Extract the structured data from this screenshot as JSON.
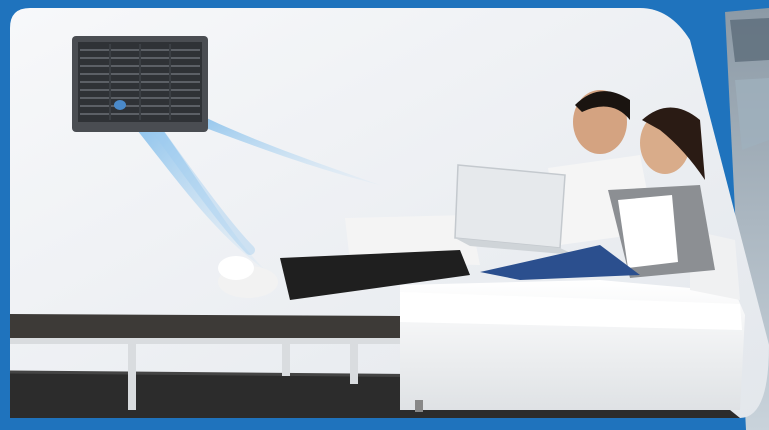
{
  "scene": {
    "description_free": true,
    "colors": {
      "frame_blue": "#1f73bd",
      "wall": "#eef1f4",
      "airflow": "#8fc6ee",
      "sofa": "#f6f6f6",
      "rug": "#2d2d2d",
      "table_top": "#3c3a38"
    },
    "icons": [
      "air-conditioner-icon"
    ]
  }
}
